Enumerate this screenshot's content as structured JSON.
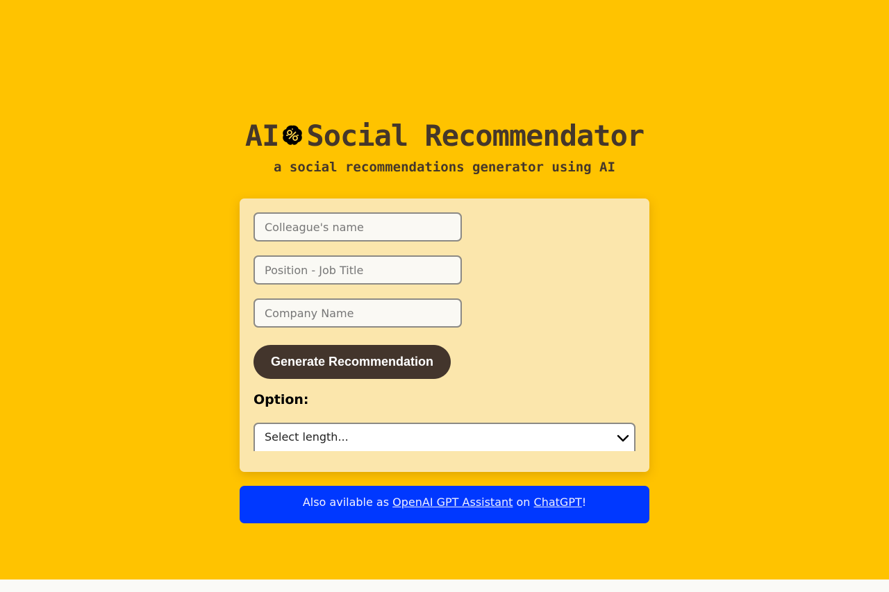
{
  "header": {
    "title_prefix": "AI",
    "title_icon": "brain-icon",
    "title_main": "Social Recommendator",
    "subtitle": "a social recommendations generator using AI"
  },
  "form": {
    "name_placeholder": "Colleague's name",
    "position_placeholder": "Position - Job Title",
    "company_placeholder": "Company Name",
    "generate_label": "Generate Recommendation",
    "option_label": "Option:",
    "length_select_value": "Select length..."
  },
  "banner": {
    "text_before": "Also avilable as ",
    "link1": "OpenAI GPT Assistant",
    "text_middle": " on ",
    "link2": "ChatGPT",
    "text_after": "!"
  },
  "colors": {
    "background": "#ffc300",
    "card": "#fbe6ac",
    "text": "#45372a",
    "button": "#43352c",
    "banner": "#0038ff"
  }
}
